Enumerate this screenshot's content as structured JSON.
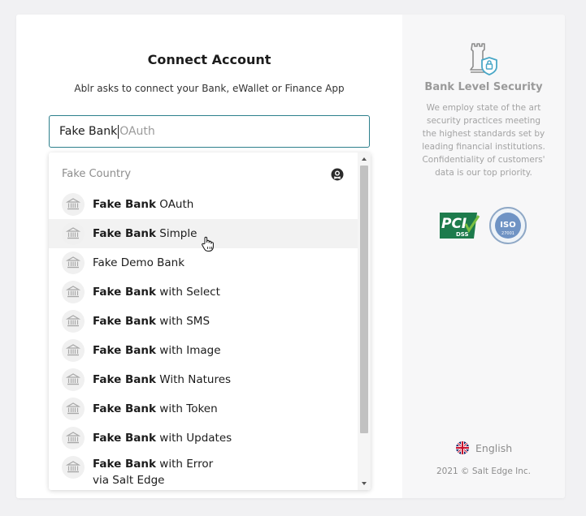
{
  "header": {
    "title": "Connect Account",
    "subtitle": "Ablr asks to connect your Bank, eWallet or Finance App"
  },
  "search": {
    "typed": "Fake Bank",
    "suggestion": "OAuth"
  },
  "dropdown": {
    "country": "Fake Country",
    "hovered_index": 1,
    "items": [
      {
        "bold": "Fake Bank",
        "rest": " OAuth"
      },
      {
        "bold": "Fake Bank",
        "rest": " Simple"
      },
      {
        "bold": "",
        "rest": "Fake Demo Bank"
      },
      {
        "bold": "Fake Bank",
        "rest": " with Select"
      },
      {
        "bold": "Fake Bank",
        "rest": " with SMS"
      },
      {
        "bold": "Fake Bank",
        "rest": " with Image"
      },
      {
        "bold": "Fake Bank",
        "rest": " With Natures"
      },
      {
        "bold": "Fake Bank",
        "rest": " with Token"
      },
      {
        "bold": "Fake Bank",
        "rest": " with Updates"
      },
      {
        "bold": "Fake Bank",
        "rest": " with Error",
        "line2": "via Salt Edge"
      }
    ]
  },
  "security": {
    "title": "Bank Level Security",
    "text": "We employ state of the art security practices meeting the highest standards set by leading financial institutions. Confidentiality of customers' data is our top priority.",
    "pci_label": "PCI",
    "pci_sub": "DSS",
    "iso_label": "ISO",
    "iso_num": "27001"
  },
  "footer": {
    "language": "English",
    "copyright": "2021 © Salt Edge Inc."
  },
  "colors": {
    "accent": "#2d7f8c",
    "pci_green": "#1d7b4c"
  },
  "icons": [
    "bank-icon",
    "globe-icon",
    "tower-lock-icon",
    "uk-flag-icon",
    "hand-cursor-icon"
  ]
}
